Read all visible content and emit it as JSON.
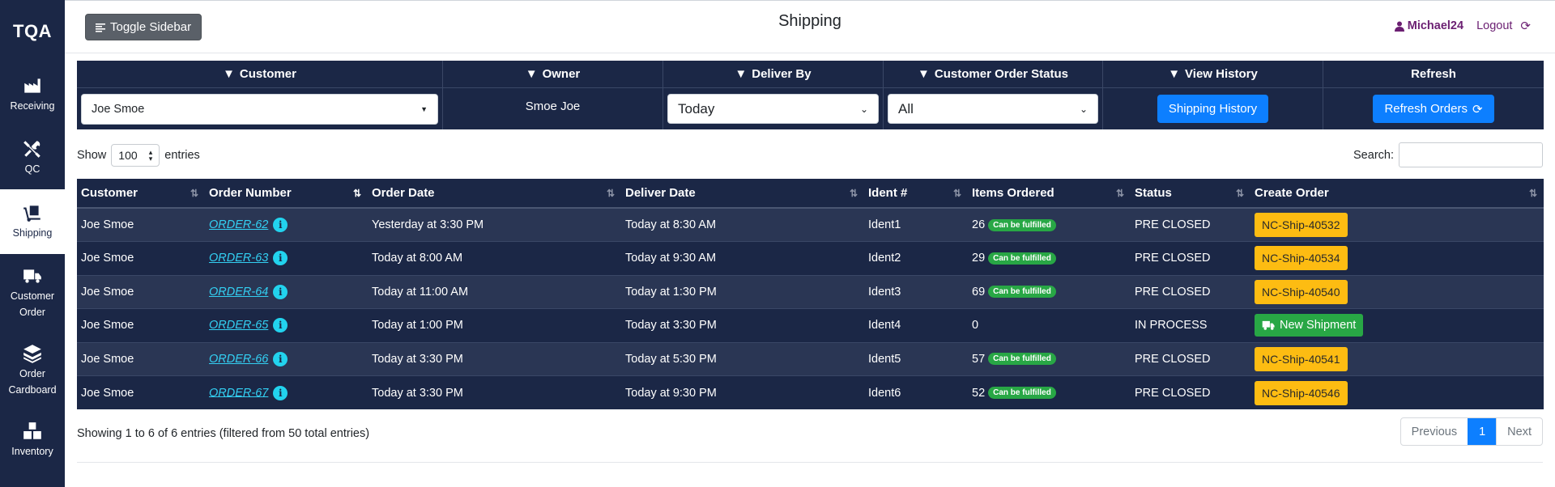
{
  "sidebar": {
    "brand": "TQA",
    "items": [
      {
        "label": "Receiving",
        "icon": "industry-icon"
      },
      {
        "label": "QC",
        "icon": "tools-icon"
      },
      {
        "label": "Shipping",
        "icon": "dolly-icon",
        "active": true
      },
      {
        "label": "Customer Order",
        "icon": "truck-icon"
      },
      {
        "label": "Order Cardboard",
        "icon": "layers-icon"
      },
      {
        "label": "Inventory",
        "icon": "boxes-icon"
      }
    ]
  },
  "header": {
    "toggle_label": "Toggle Sidebar",
    "title": "Shipping",
    "username": "Michael24",
    "logout_label": "Logout"
  },
  "filters": {
    "customer": {
      "header": "Customer",
      "value": "Joe Smoe"
    },
    "owner": {
      "header": "Owner",
      "value": "Smoe Joe"
    },
    "deliver_by": {
      "header": "Deliver By",
      "value": "Today"
    },
    "order_status": {
      "header": "Customer Order Status",
      "value": "All"
    },
    "view_history": {
      "header": "View History",
      "button": "Shipping History"
    },
    "refresh": {
      "header": "Refresh",
      "button": "Refresh Orders"
    }
  },
  "table_controls": {
    "show_label": "Show",
    "length_value": "100",
    "entries_label": "entries",
    "search_label": "Search:",
    "search_value": ""
  },
  "table": {
    "columns": [
      "Customer",
      "Order Number",
      "Order Date",
      "Deliver Date",
      "Ident #",
      "Items Ordered",
      "Status",
      "Create Order"
    ],
    "rows": [
      {
        "customer": "Joe Smoe",
        "order": "ORDER-62",
        "order_date": "Yesterday at 3:30 PM",
        "deliver_date": "Today at 8:30 AM",
        "ident": "Ident1",
        "items": "26",
        "fulfill": "Can be fulfilled",
        "status": "PRE CLOSED",
        "create": "NC-Ship-40532"
      },
      {
        "customer": "Joe Smoe",
        "order": "ORDER-63",
        "order_date": "Today at 8:00 AM",
        "deliver_date": "Today at 9:30 AM",
        "ident": "Ident2",
        "items": "29",
        "fulfill": "Can be fulfilled",
        "status": "PRE CLOSED",
        "create": "NC-Ship-40534"
      },
      {
        "customer": "Joe Smoe",
        "order": "ORDER-64",
        "order_date": "Today at 11:00 AM",
        "deliver_date": "Today at 1:30 PM",
        "ident": "Ident3",
        "items": "69",
        "fulfill": "Can be fulfilled",
        "status": "PRE CLOSED",
        "create": "NC-Ship-40540"
      },
      {
        "customer": "Joe Smoe",
        "order": "ORDER-65",
        "order_date": "Today at 1:00 PM",
        "deliver_date": "Today at 3:30 PM",
        "ident": "Ident4",
        "items": "0",
        "fulfill": "",
        "status": "IN PROCESS",
        "create": "New Shipment"
      },
      {
        "customer": "Joe Smoe",
        "order": "ORDER-66",
        "order_date": "Today at 3:30 PM",
        "deliver_date": "Today at 5:30 PM",
        "ident": "Ident5",
        "items": "57",
        "fulfill": "Can be fulfilled",
        "status": "PRE CLOSED",
        "create": "NC-Ship-40541"
      },
      {
        "customer": "Joe Smoe",
        "order": "ORDER-67",
        "order_date": "Today at 3:30 PM",
        "deliver_date": "Today at 9:30 PM",
        "ident": "Ident6",
        "items": "52",
        "fulfill": "Can be fulfilled",
        "status": "PRE CLOSED",
        "create": "NC-Ship-40546"
      }
    ]
  },
  "footer": {
    "info": "Showing 1 to 6 of 6 entries (filtered from 50 total entries)",
    "previous": "Previous",
    "current_page": "1",
    "next": "Next"
  },
  "colors": {
    "navy": "#1b2746",
    "row_alt": "#2a3654",
    "primary": "#0d7fff",
    "warning": "#fdbc12",
    "success": "#28a745",
    "link": "#33d0f3",
    "user_purple": "#6b1f72"
  }
}
